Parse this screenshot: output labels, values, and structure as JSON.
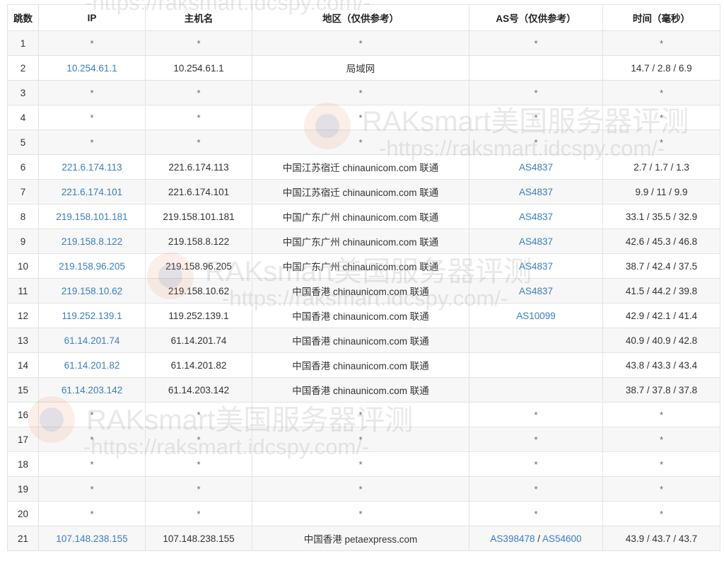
{
  "headers": [
    "跳数",
    "IP",
    "主机名",
    "地区（仅供参考）",
    "AS号（仅供参考）",
    "时间（毫秒）"
  ],
  "rows": [
    {
      "hop": "1",
      "ip": "*",
      "host": "*",
      "region": "*",
      "as": [
        "*"
      ],
      "time": "*"
    },
    {
      "hop": "2",
      "ip": "10.254.61.1",
      "host": "10.254.61.1",
      "region": "局域网",
      "as": [],
      "time": "14.7 / 2.8 / 6.9"
    },
    {
      "hop": "3",
      "ip": "*",
      "host": "*",
      "region": "*",
      "as": [
        "*"
      ],
      "time": "*"
    },
    {
      "hop": "4",
      "ip": "*",
      "host": "*",
      "region": "*",
      "as": [
        "*"
      ],
      "time": "*"
    },
    {
      "hop": "5",
      "ip": "*",
      "host": "*",
      "region": "*",
      "as": [
        "*"
      ],
      "time": "*"
    },
    {
      "hop": "6",
      "ip": "221.6.174.113",
      "host": "221.6.174.113",
      "region": "中国江苏宿迁 chinaunicom.com 联通",
      "as": [
        "AS4837"
      ],
      "time": "2.7 / 1.7 / 1.3"
    },
    {
      "hop": "7",
      "ip": "221.6.174.101",
      "host": "221.6.174.101",
      "region": "中国江苏宿迁 chinaunicom.com 联通",
      "as": [
        "AS4837"
      ],
      "time": "9.9 / 11 / 9.9"
    },
    {
      "hop": "8",
      "ip": "219.158.101.181",
      "host": "219.158.101.181",
      "region": "中国广东广州 chinaunicom.com 联通",
      "as": [
        "AS4837"
      ],
      "time": "33.1 / 35.5 / 32.9"
    },
    {
      "hop": "9",
      "ip": "219.158.8.122",
      "host": "219.158.8.122",
      "region": "中国广东广州 chinaunicom.com 联通",
      "as": [
        "AS4837"
      ],
      "time": "42.6 / 45.3 / 46.8"
    },
    {
      "hop": "10",
      "ip": "219.158.96.205",
      "host": "219.158.96.205",
      "region": "中国广东广州 chinaunicom.com 联通",
      "as": [
        "AS4837"
      ],
      "time": "38.7 / 42.4 / 37.5"
    },
    {
      "hop": "11",
      "ip": "219.158.10.62",
      "host": "219.158.10.62",
      "region": "中国香港 chinaunicom.com 联通",
      "as": [
        "AS4837"
      ],
      "time": "41.5 / 44.2 / 39.8"
    },
    {
      "hop": "12",
      "ip": "119.252.139.1",
      "host": "119.252.139.1",
      "region": "中国香港 chinaunicom.com 联通",
      "as": [
        "AS10099"
      ],
      "time": "42.9 / 42.1 / 41.4"
    },
    {
      "hop": "13",
      "ip": "61.14.201.74",
      "host": "61.14.201.74",
      "region": "中国香港 chinaunicom.com 联通",
      "as": [],
      "time": "40.9 / 40.9 / 42.8"
    },
    {
      "hop": "14",
      "ip": "61.14.201.82",
      "host": "61.14.201.82",
      "region": "中国香港 chinaunicom.com 联通",
      "as": [],
      "time": "43.8 / 43.3 / 43.4"
    },
    {
      "hop": "15",
      "ip": "61.14.203.142",
      "host": "61.14.203.142",
      "region": "中国香港 chinaunicom.com 联通",
      "as": [],
      "time": "38.7 / 37.8 / 37.8"
    },
    {
      "hop": "16",
      "ip": "*",
      "host": "*",
      "region": "*",
      "as": [
        "*"
      ],
      "time": "*"
    },
    {
      "hop": "17",
      "ip": "*",
      "host": "*",
      "region": "*",
      "as": [
        "*"
      ],
      "time": "*"
    },
    {
      "hop": "18",
      "ip": "*",
      "host": "*",
      "region": "*",
      "as": [
        "*"
      ],
      "time": "*"
    },
    {
      "hop": "19",
      "ip": "*",
      "host": "*",
      "region": "*",
      "as": [
        "*"
      ],
      "time": "*"
    },
    {
      "hop": "20",
      "ip": "*",
      "host": "*",
      "region": "*",
      "as": [
        "*"
      ],
      "time": "*"
    },
    {
      "hop": "21",
      "ip": "107.148.238.155",
      "host": "107.148.238.155",
      "region": "中国香港 petaexpress.com",
      "as": [
        "AS398478",
        "AS54600"
      ],
      "time": "43.9 / 43.7 / 43.7"
    }
  ],
  "watermark": {
    "title": "RAKsmart美国服务器评测",
    "url": "-https://raksmart.idcspy.com/-"
  },
  "colors": {
    "link": "#3a7fc1",
    "border": "#e3e3e3",
    "stripe": "#f7f7f7"
  }
}
